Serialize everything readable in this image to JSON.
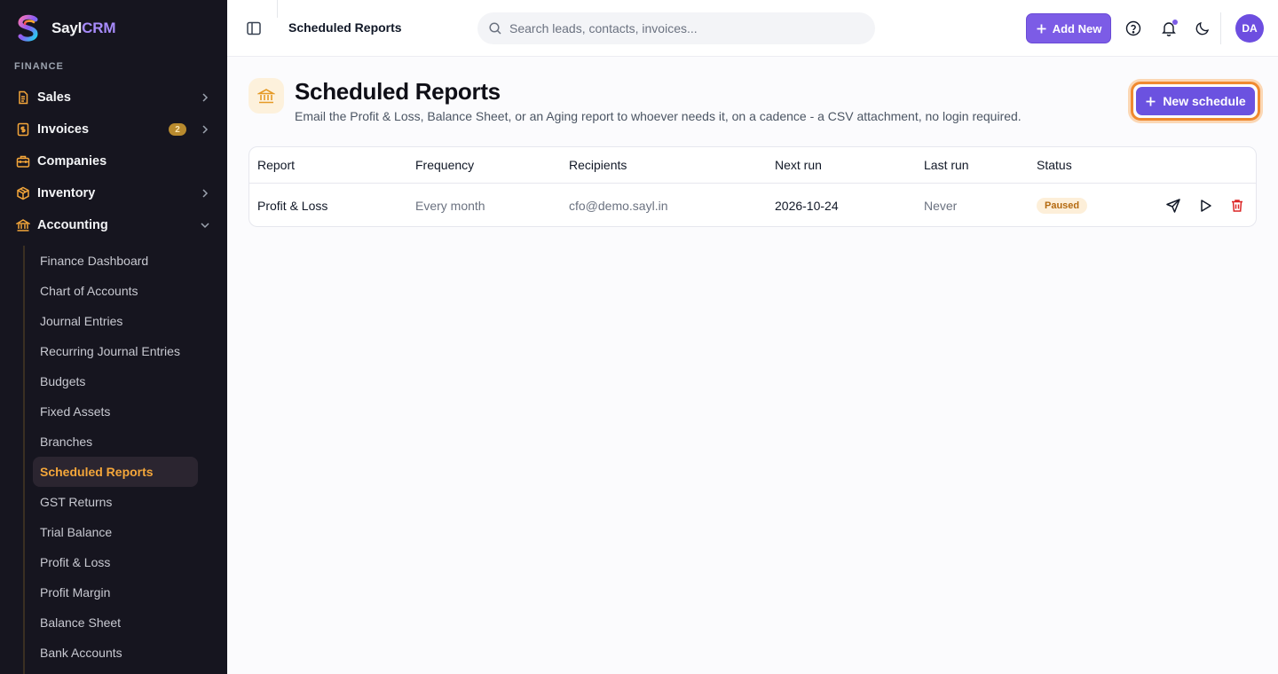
{
  "brand": {
    "name_main": "Sayl",
    "name_accent": "CRM"
  },
  "sidebar": {
    "section_label": "FINANCE",
    "items": [
      {
        "label": "Sales",
        "icon": "document-icon"
      },
      {
        "label": "Invoices",
        "icon": "dollar-doc-icon",
        "badge": "2"
      },
      {
        "label": "Companies",
        "icon": "briefcase-icon"
      },
      {
        "label": "Inventory",
        "icon": "package-icon"
      },
      {
        "label": "Accounting",
        "icon": "bank-icon"
      }
    ],
    "subitems": [
      "Finance Dashboard",
      "Chart of Accounts",
      "Journal Entries",
      "Recurring Journal Entries",
      "Budgets",
      "Fixed Assets",
      "Branches",
      "Scheduled Reports",
      "GST Returns",
      "Trial Balance",
      "Profit & Loss",
      "Profit Margin",
      "Balance Sheet",
      "Bank Accounts"
    ],
    "active_subitem": "Scheduled Reports"
  },
  "topbar": {
    "title": "Scheduled Reports",
    "search_placeholder": "Search leads, contacts, invoices...",
    "add_new_label": "Add New",
    "avatar_initials": "DA"
  },
  "page": {
    "title": "Scheduled Reports",
    "subtitle": "Email the Profit & Loss, Balance Sheet, or an Aging report to whoever needs it, on a cadence - a CSV attachment, no login required.",
    "new_schedule_label": "New schedule"
  },
  "table": {
    "headers": [
      "Report",
      "Frequency",
      "Recipients",
      "Next run",
      "Last run",
      "Status"
    ],
    "rows": [
      {
        "report": "Profit & Loss",
        "frequency": "Every month",
        "recipients": "cfo@demo.sayl.in",
        "next_run": "2026-10-24",
        "last_run": "Never",
        "status": "Paused"
      }
    ]
  },
  "colors": {
    "accent": "#6b52e0",
    "active_nav": "#f4a63a",
    "status_paused": "#b46a10",
    "delete": "#dc2626"
  }
}
